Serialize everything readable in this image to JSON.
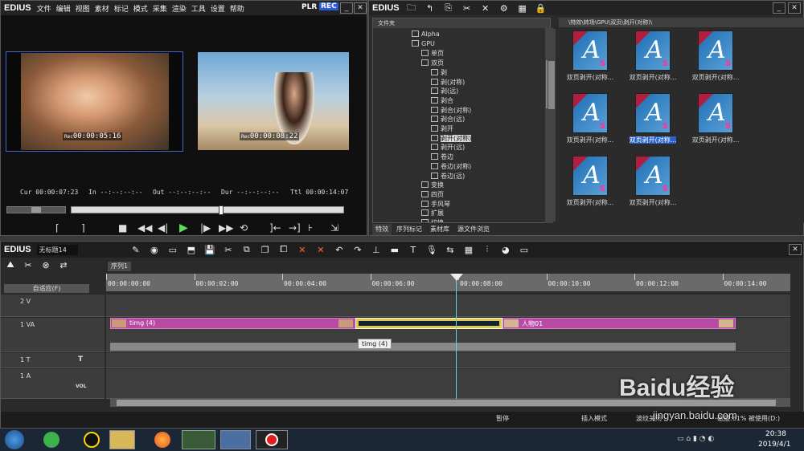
{
  "player": {
    "app": "EDIUS",
    "menu": [
      "文件",
      "编辑",
      "视图",
      "素材",
      "标记",
      "模式",
      "采集",
      "渲染",
      "工具",
      "设置",
      "帮助"
    ],
    "plr": "PLR",
    "rec": "REC",
    "tc_left": "00:00:05:16",
    "tc_right": "00:00:08:22",
    "tc_prefix": "Rec",
    "cur_label": "Cur",
    "cur": "00:00:07:23",
    "in_label": "In",
    "in": "--:--:--:--",
    "out_label": "Out",
    "out": "--:--:--:--",
    "dur_label": "Dur",
    "dur": "--:--:--:--",
    "ttl_label": "Ttl",
    "ttl": "00:00:14:07"
  },
  "bin": {
    "app": "EDIUS",
    "folder_header": "文件夹",
    "path": "\\特效\\转场\\GPU\\双页\\剥开(对称)\\",
    "tree": [
      "Alpha",
      "GPU",
      "单页",
      "双页",
      "剥",
      "剥(对称)",
      "剥(远)",
      "剥合",
      "剥合(对称)",
      "剥合(远)",
      "剥开",
      "剥开(对称)",
      "剥开(远)",
      "卷边",
      "卷边(对称)",
      "卷边(远)",
      "变换",
      "四页",
      "手风琴",
      "扩展",
      "切换"
    ],
    "effects": [
      "双页剥开(对称...",
      "双页剥开(对称...",
      "双页剥开(对称...",
      "双页剥开(对称...",
      "双页剥开(对称...",
      "双页剥开(对称...",
      "双页剥开(对称...",
      "双页剥开(对称..."
    ],
    "tabs": [
      "特效",
      "序列标记",
      "素材库",
      "源文件浏览"
    ]
  },
  "timeline": {
    "app": "EDIUS",
    "project": "无标题14",
    "seq": "序列1",
    "mode": "自适应(F)",
    "ticks": [
      "00:00:00:00",
      "00:00:02:00",
      "00:00:04:00",
      "00:00:06:00",
      "00:00:08:00",
      "00:00:10:00",
      "00:00:12:00",
      "00:00:14:00"
    ],
    "tracks": [
      {
        "name": "2 V",
        "tag": ""
      },
      {
        "name": "1 VA",
        "tag": ""
      },
      {
        "name": "1 T",
        "tag": "T"
      },
      {
        "name": "1 A",
        "tag": "VOL"
      }
    ],
    "clip1": "timg (4)",
    "clip2": "人物01",
    "tooltip": "timg (4)",
    "status": [
      "暂停",
      "插入模式",
      "波纹关闭",
      "磁盘:61% 被使用(D:)"
    ]
  },
  "taskbar": {
    "time": "20:38",
    "date": "2019/4/1"
  },
  "watermark": {
    "text": "Baidu经验",
    "url": "jingyan.baidu.com"
  }
}
